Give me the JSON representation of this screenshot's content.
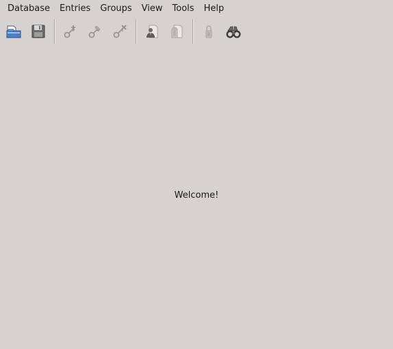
{
  "menubar": {
    "items": [
      {
        "label": "Database"
      },
      {
        "label": "Entries"
      },
      {
        "label": "Groups"
      },
      {
        "label": "View"
      },
      {
        "label": "Tools"
      },
      {
        "label": "Help"
      }
    ]
  },
  "toolbar": {
    "buttons": [
      {
        "icon": "open-database-icon",
        "enabled": true
      },
      {
        "icon": "save-database-icon",
        "enabled": true
      },
      {
        "icon": "add-entry-icon",
        "enabled": false
      },
      {
        "icon": "edit-entry-icon",
        "enabled": false
      },
      {
        "icon": "delete-entry-icon",
        "enabled": false
      },
      {
        "icon": "copy-username-icon",
        "enabled": false
      },
      {
        "icon": "copy-password-icon",
        "enabled": false
      },
      {
        "icon": "lock-workspace-icon",
        "enabled": false
      },
      {
        "icon": "search-icon",
        "enabled": true
      }
    ]
  },
  "main": {
    "welcome_text": "Welcome!"
  }
}
